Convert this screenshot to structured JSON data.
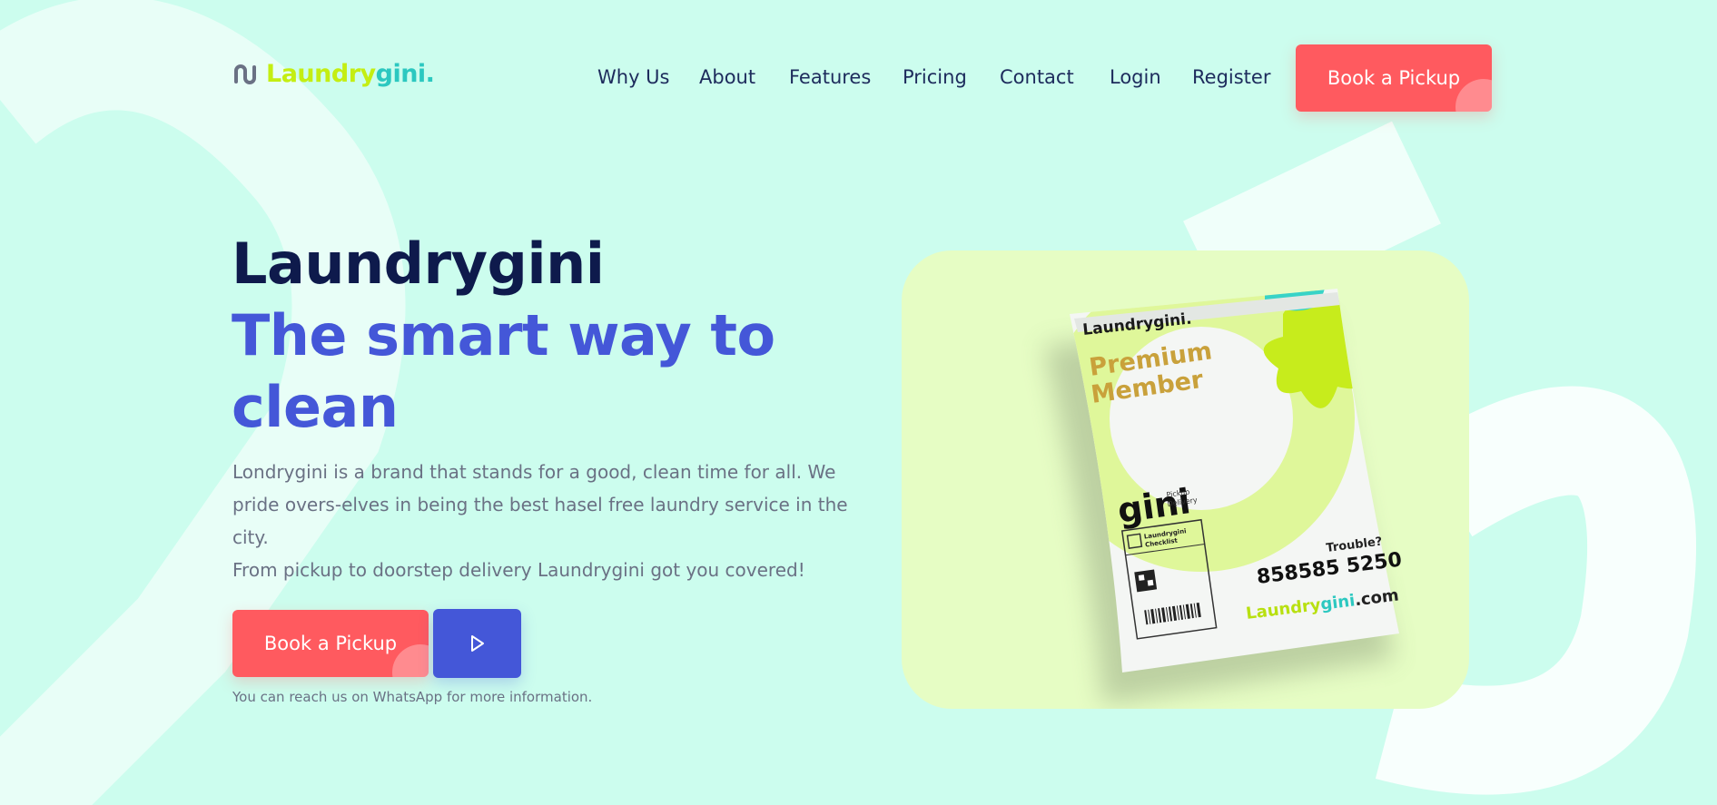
{
  "brand": {
    "logo_text_part1": "Laundry",
    "logo_text_part2": "gini.",
    "colors": {
      "lime": "#c4ee12",
      "teal": "#2cc8c0",
      "coral": "#ff5a5f",
      "indigo": "#4457d8",
      "navy": "#0e1a4c",
      "background": "#ccfdee"
    }
  },
  "nav": {
    "items": [
      "Why Us",
      "About",
      "Features",
      "Pricing",
      "Contact",
      "Login",
      "Register"
    ],
    "cta_label": "Book a Pickup"
  },
  "hero": {
    "title": "Laundrygini",
    "subtitle": "The smart way to clean",
    "description": "Londrygini is a brand that stands for a good, clean time for all. We pride overs-elves in being the best hasel free laundry service in the city.",
    "description2": "From pickup to doorstep delivery Laundrygini got you covered!",
    "cta_label": "Book a Pickup",
    "play_icon": "play-icon",
    "note": "You can reach us on WhatsApp for more information."
  },
  "product_image": {
    "bag_brand": "Laundrygini.",
    "bag_tagline": "Premium",
    "bag_tagline2": "Member",
    "bag_logo_word": "gini",
    "bag_logo_sub1": "Pickup",
    "bag_logo_sub2": "Delivery",
    "checklist_title1": "Laundrygini",
    "checklist_title2": "Checklist",
    "trouble": "Trouble?",
    "phone": "858585 5250",
    "website_part1": "Laundry",
    "website_part2": "gini",
    "website_part3": ".com"
  }
}
